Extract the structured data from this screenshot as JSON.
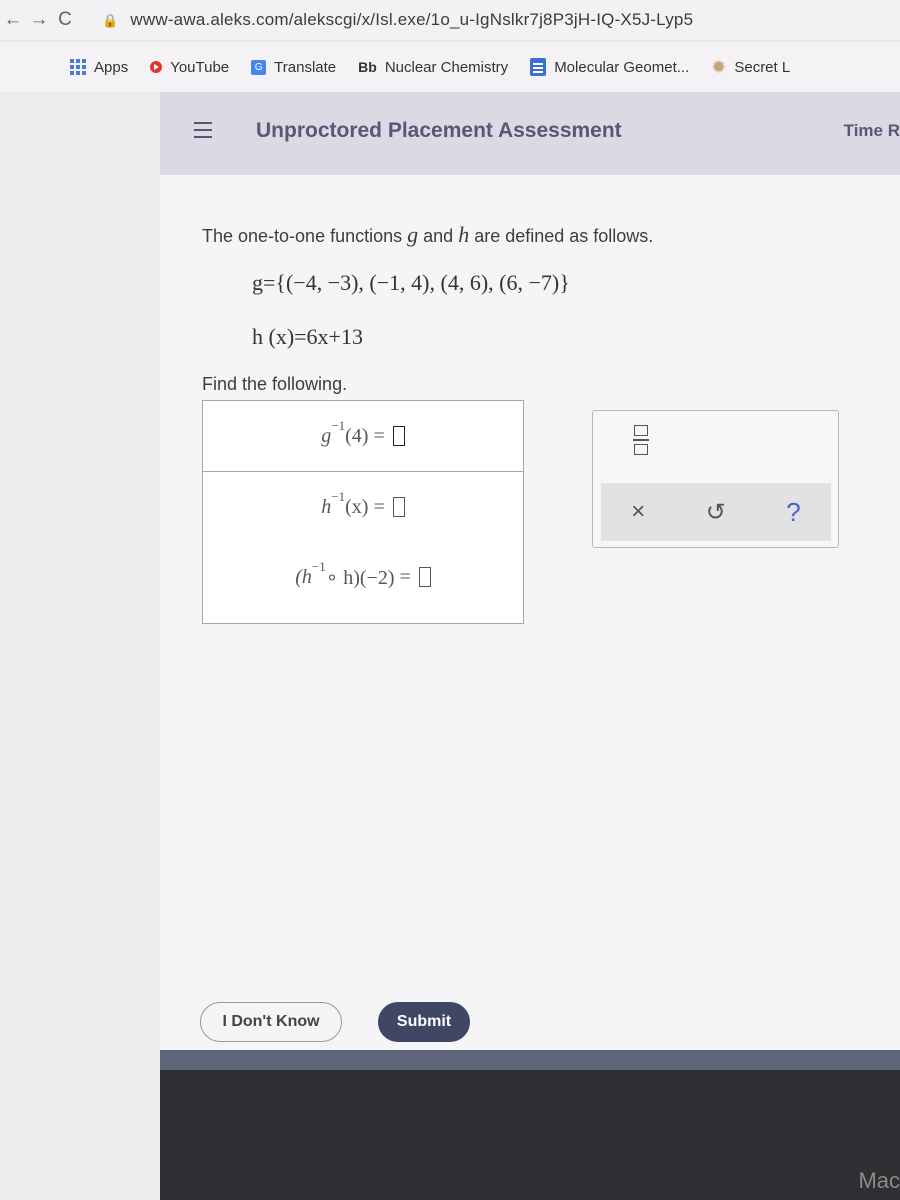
{
  "browser": {
    "url": "www-awa.aleks.com/alekscgi/x/Isl.exe/1o_u-IgNslkr7j8P3jH-IQ-X5J-Lyp5",
    "nav": {
      "back": "←",
      "forward": "→",
      "reload": "C"
    },
    "bookmarks": [
      {
        "label": "Apps",
        "icon": "apps-grid-icon"
      },
      {
        "label": "YouTube",
        "icon": "youtube-icon"
      },
      {
        "label": "Translate",
        "icon": "translate-icon"
      },
      {
        "label": "Nuclear Chemistry",
        "icon": "blackboard-icon",
        "prefix": "Bb"
      },
      {
        "label": "Molecular Geomet...",
        "icon": "doc-icon"
      },
      {
        "label": "Secret L",
        "icon": "star-badge-icon"
      }
    ]
  },
  "app": {
    "title": "Unproctored Placement Assessment",
    "timer_label": "Time R"
  },
  "question": {
    "prompt_pre": "The one-to-one functions ",
    "g": "g",
    "and": " and ",
    "h": "h",
    "prompt_post": " are defined as follows.",
    "g_def": "g={(−4, −3), (−1, 4), (4, 6), (6, −7)}",
    "h_def": "h (x)=6x+13",
    "find_label": "Find the following.",
    "answers": [
      {
        "expr": "g",
        "sup": "−1",
        "arg": "(4)",
        "eq": "=",
        "value": ""
      },
      {
        "expr": "h",
        "sup": "−1",
        "arg": "(x)",
        "eq": "=",
        "value": ""
      },
      {
        "expr": "(h",
        "sup": "−1",
        "arg": " ∘ h)(−2)",
        "eq": "=",
        "value": ""
      }
    ]
  },
  "keypad": {
    "fraction_icon": "fraction-icon",
    "clear": "×",
    "undo": "↺",
    "help": "?"
  },
  "footer": {
    "dont_know": "I Don't Know",
    "submit": "Submit"
  },
  "device": {
    "label": "Mac"
  }
}
